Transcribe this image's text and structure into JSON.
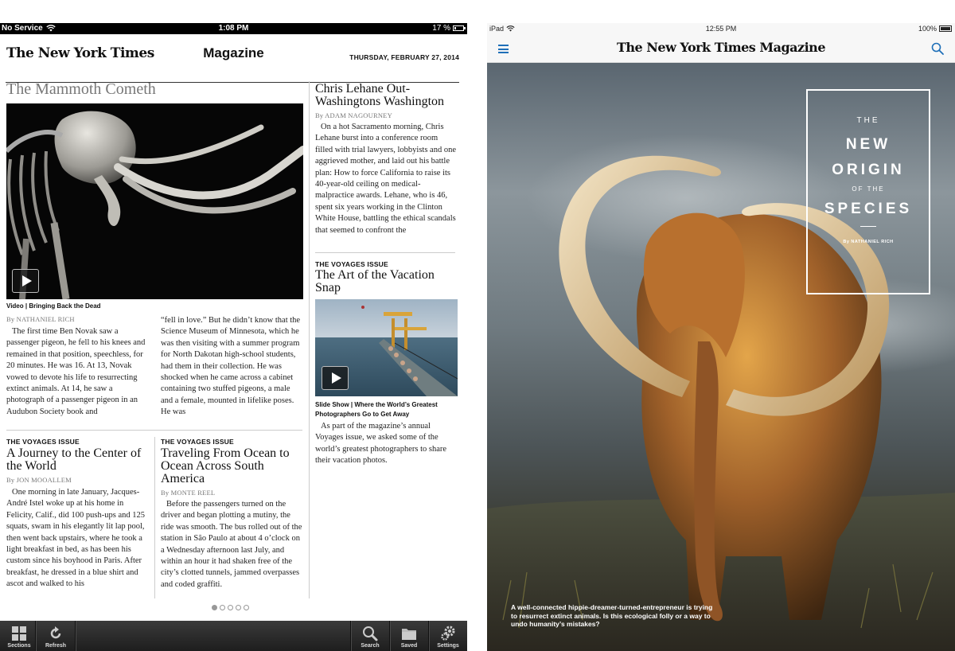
{
  "left_device": {
    "status_bar": {
      "carrier": "No Service",
      "time": "1:08 PM",
      "battery": "17 %",
      "battery_level": 0.17
    },
    "header": {
      "logo": "The New York Times",
      "section": "Magazine",
      "date": "THURSDAY, FEBRUARY 27, 2014"
    },
    "lead": {
      "title": "The Mammoth Cometh",
      "caption": "Video | Bringing Back the Dead",
      "byline": "By NATHANIEL RICH",
      "body_col1": "The first time Ben Novak saw a passenger pigeon, he fell to his knees and remained in that position, speechless, for 20 minutes. He was 16. At 13, Novak vowed to devote his life to resurrecting extinct animals. At 14, he saw a photograph of a passenger pigeon in an Audubon Society book and",
      "body_col2": "“fell in love.” But he didn’t know that the Science Museum of Minnesota, which he was then visiting with a summer program for North Dakotan high-school students, had them in their collection. He was shocked when he came across a cabinet containing two stuffed pigeons, a male and a female, mounted in lifelike poses. He was"
    },
    "sidebar_story": {
      "headline": "Chris Lehane Out-Washingtons Washington",
      "byline": "By ADAM NAGOURNEY",
      "body": "On a hot Sacramento morning, Chris Lehane burst into a conference room filled with trial lawyers, lobbyists and one aggrieved mother, and laid out his battle plan: How to force California to raise its 40-year-old ceiling on medical-malpractice awards. Lehane, who is 46, spent six years working in the Clinton White House, battling the ethical scandals that seemed to confront the"
    },
    "vacation_story": {
      "kicker": "THE VOYAGES ISSUE",
      "headline": "The Art of the Vacation Snap",
      "caption": "Slide Show | Where the World’s Greatest Photographers Go to Get Away",
      "body": "As part of the magazine’s annual Voyages issue, we asked some of the world’s greatest photographers to share their vacation photos."
    },
    "journey_story": {
      "kicker": "THE VOYAGES ISSUE",
      "headline": "A Journey to the Center of the World",
      "byline": "By JON MOOALLEM",
      "body": "One morning in late January, Jacques-André Istel woke up at his home in Felicity, Calif., did 100 push-ups and 125 squats, swam in his elegantly lit lap pool, then went back upstairs, where he took a light breakfast in bed, as has been his custom since his boyhood in Paris. After breakfast, he dressed in a blue shirt and ascot and walked to his"
    },
    "ocean_story": {
      "kicker": "THE VOYAGES ISSUE",
      "headline": "Traveling From Ocean to Ocean Across South America",
      "byline": "By MONTE REEL",
      "body": "Before the passengers turned on the driver and began plotting a mutiny, the ride was smooth. The bus rolled out of the station in São Paulo at about 4 o’clock on a Wednesday afternoon last July, and within an hour it had shaken free of the city’s clotted tunnels, jammed overpasses and coded graffiti."
    },
    "page_indicator": {
      "current": 1,
      "total": 5
    },
    "toolbar": {
      "sections": "Sections",
      "refresh": "Refresh",
      "search": "Search",
      "saved": "Saved",
      "settings": "Settings"
    }
  },
  "right_device": {
    "status_bar": {
      "device": "iPad",
      "time": "12:55 PM",
      "battery": "100%",
      "battery_level": 1.0
    },
    "header": {
      "logo": "The New York Times Magazine"
    },
    "cover": {
      "line1": "THE",
      "line2": "NEW",
      "line3": "ORIGIN",
      "line4": "OF THE",
      "line5": "SPECIES",
      "byline": "By NATHANIEL RICH",
      "caption": "A well-connected hippie-dreamer-turned-entrepreneur is trying to resurrect extinct animals. Is this ecological folly or a way to undo humanity’s mistakes?"
    }
  },
  "colors": {
    "accent_blue": "#1e6fb8",
    "toolbar_dark": "#2a2a2a",
    "rule": "#cccccc"
  }
}
